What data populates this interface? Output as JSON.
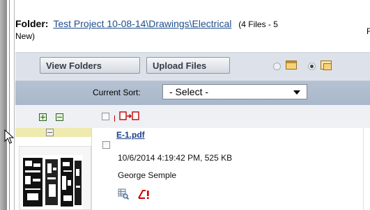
{
  "folder": {
    "label": "Folder:",
    "path": "Test Project 10-08-14\\Drawings\\Electrical",
    "count_line1": "(4 Files - 5",
    "count_line2": "New)",
    "cut_letter": "F"
  },
  "toolbar": {
    "view_folders": "View Folders",
    "upload_files": "Upload Files",
    "view_mode_selected": "tiles"
  },
  "sort": {
    "label": "Current Sort:",
    "value": "- Select -"
  },
  "file": {
    "name": "E-1.pdf",
    "date_size": "10/6/2014 4:19:42 PM, 525 KB",
    "author": "George Semple"
  },
  "icons": {
    "expand": "plus-icon",
    "collapse": "minus-icon",
    "copy_move": "copy-move-icon",
    "view": "view-details-icon",
    "markup": "markup-alert-icon"
  }
}
